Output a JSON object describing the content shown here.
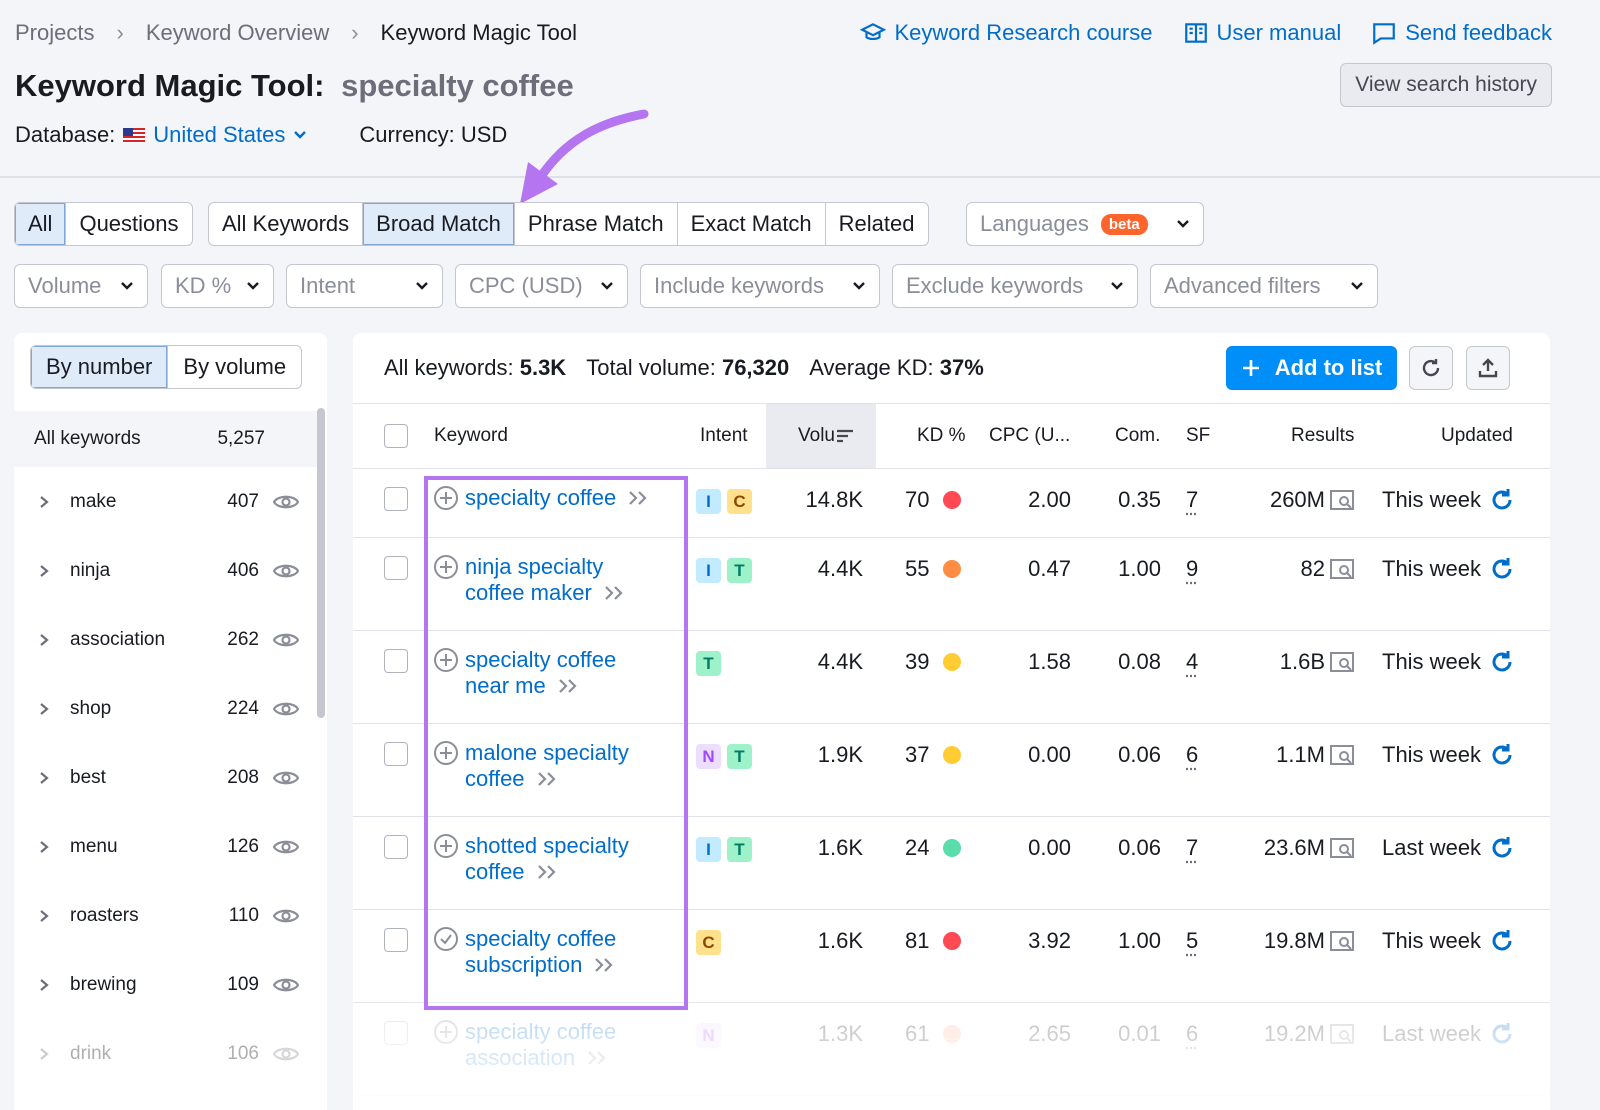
{
  "breadcrumb": [
    "Projects",
    "Keyword Overview",
    "Keyword Magic Tool"
  ],
  "top_links": {
    "course": "Keyword Research course",
    "manual": "User manual",
    "feedback": "Send feedback"
  },
  "title": {
    "tool": "Keyword Magic Tool:",
    "keyword": "specialty coffee"
  },
  "history_button": "View search history",
  "database": {
    "label": "Database:",
    "country": "United States",
    "currency": "Currency: USD"
  },
  "tabs_a": [
    "All",
    "Questions"
  ],
  "tabs_b": [
    "All Keywords",
    "Broad Match",
    "Phrase Match",
    "Exact Match",
    "Related"
  ],
  "active_tab_a": "All",
  "active_tab_b": "Broad Match",
  "languages": {
    "label": "Languages",
    "badge": "beta"
  },
  "filters": [
    "Volume",
    "KD %",
    "Intent",
    "CPC (USD)",
    "Include keywords",
    "Exclude keywords",
    "Advanced filters"
  ],
  "left_panel": {
    "toggle": [
      "By number",
      "By volume"
    ],
    "all_keywords": {
      "label": "All keywords",
      "count": "5,257"
    },
    "groups": [
      {
        "name": "make",
        "count": "407"
      },
      {
        "name": "ninja",
        "count": "406"
      },
      {
        "name": "association",
        "count": "262"
      },
      {
        "name": "shop",
        "count": "224"
      },
      {
        "name": "best",
        "count": "208"
      },
      {
        "name": "menu",
        "count": "126"
      },
      {
        "name": "roasters",
        "count": "110"
      },
      {
        "name": "brewing",
        "count": "109"
      },
      {
        "name": "drink",
        "count": "106"
      }
    ]
  },
  "summary": {
    "all_label": "All keywords:",
    "all_value": "5.3K",
    "vol_label": "Total volume:",
    "vol_value": "76,320",
    "kd_label": "Average KD:",
    "kd_value": "37%"
  },
  "add_button": "Add to list",
  "columns": [
    "Keyword",
    "Intent",
    "Volu",
    "KD %",
    "CPC (U...",
    "Com.",
    "SF",
    "Results",
    "Updated"
  ],
  "colors": {
    "accent": "#006dca",
    "primary_button": "#008ff8",
    "highlight": "#b574f0",
    "kd_red": "#ff4953",
    "kd_orange": "#ff8c43",
    "kd_yellow": "#ffcc33",
    "kd_green": "#59ddaa"
  },
  "rows": [
    {
      "keyword_lines": [
        "specialty coffee"
      ],
      "intent": [
        "I",
        "C"
      ],
      "volume": "14.8K",
      "kd": "70",
      "kd_color": "#ff4953",
      "cpc": "2.00",
      "com": "0.35",
      "sf": "7",
      "results": "260M",
      "updated": "This week",
      "icon": "plus-circle-icon"
    },
    {
      "keyword_lines": [
        "ninja specialty",
        "coffee maker"
      ],
      "intent": [
        "I",
        "T"
      ],
      "volume": "4.4K",
      "kd": "55",
      "kd_color": "#ff8c43",
      "cpc": "0.47",
      "com": "1.00",
      "sf": "9",
      "results": "82",
      "updated": "This week",
      "icon": "plus-circle-icon"
    },
    {
      "keyword_lines": [
        "specialty coffee",
        "near me"
      ],
      "intent": [
        "T"
      ],
      "volume": "4.4K",
      "kd": "39",
      "kd_color": "#ffcc33",
      "cpc": "1.58",
      "com": "0.08",
      "sf": "4",
      "results": "1.6B",
      "updated": "This week",
      "icon": "plus-circle-icon"
    },
    {
      "keyword_lines": [
        "malone specialty",
        "coffee"
      ],
      "intent": [
        "N",
        "T"
      ],
      "volume": "1.9K",
      "kd": "37",
      "kd_color": "#ffcc33",
      "cpc": "0.00",
      "com": "0.06",
      "sf": "6",
      "results": "1.1M",
      "updated": "This week",
      "icon": "plus-circle-icon"
    },
    {
      "keyword_lines": [
        "shotted specialty",
        "coffee"
      ],
      "intent": [
        "I",
        "T"
      ],
      "volume": "1.6K",
      "kd": "24",
      "kd_color": "#59ddaa",
      "cpc": "0.00",
      "com": "0.06",
      "sf": "7",
      "results": "23.6M",
      "updated": "Last week",
      "icon": "plus-circle-icon"
    },
    {
      "keyword_lines": [
        "specialty coffee",
        "subscription"
      ],
      "intent": [
        "C"
      ],
      "volume": "1.6K",
      "kd": "81",
      "kd_color": "#ff4953",
      "cpc": "3.92",
      "com": "1.00",
      "sf": "5",
      "results": "19.8M",
      "updated": "This week",
      "icon": "check-circle-icon"
    },
    {
      "keyword_lines": [
        "specialty coffee",
        "association"
      ],
      "intent": [
        "N"
      ],
      "volume": "1.3K",
      "kd": "61",
      "kd_color": "#ffb38e",
      "cpc": "2.65",
      "com": "0.01",
      "sf": "6",
      "results": "19.2M",
      "updated": "Last week",
      "icon": "plus-circle-icon"
    }
  ]
}
